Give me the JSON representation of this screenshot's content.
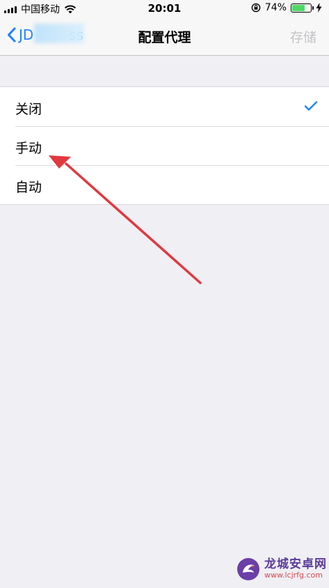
{
  "status_bar": {
    "carrier": "中国移动",
    "time": "20:01",
    "battery_percent": "74%",
    "battery_level": 0.74,
    "icons": [
      "signal-icon",
      "wifi-icon",
      "orientation-lock-icon",
      "battery-icon",
      "charging-bolt-icon"
    ]
  },
  "nav": {
    "back_label": "JD        ss",
    "title": "配置代理",
    "save_label": "存储"
  },
  "options": [
    {
      "label": "关闭",
      "selected": true
    },
    {
      "label": "手动",
      "selected": false
    },
    {
      "label": "自动",
      "selected": false
    }
  ],
  "colors": {
    "accent": "#1a82fb",
    "background": "#efeff4",
    "disabled": "#c4c4c8",
    "annotation_arrow": "#e0393e",
    "battery_fill": "#4cd964"
  },
  "watermark": {
    "title": "龙城安卓网",
    "url": "www.lcjrfg.com"
  }
}
